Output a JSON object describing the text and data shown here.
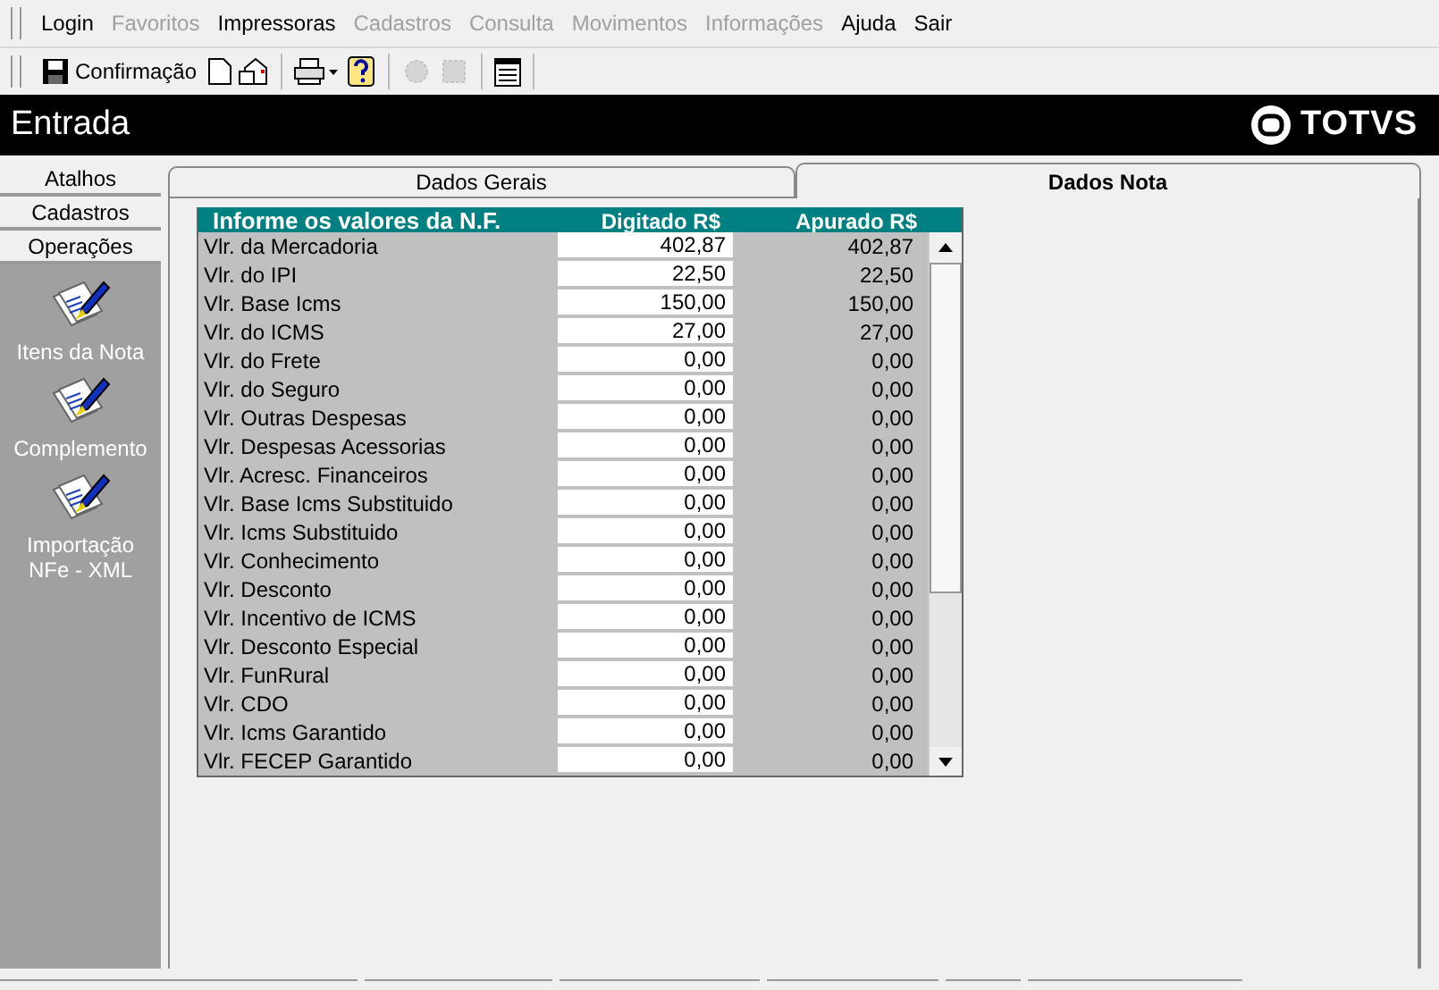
{
  "menu": [
    {
      "label": "Login",
      "disabled": false
    },
    {
      "label": "Favoritos",
      "disabled": true
    },
    {
      "label": "Impressoras",
      "disabled": false
    },
    {
      "label": "Cadastros",
      "disabled": true
    },
    {
      "label": "Consulta",
      "disabled": true
    },
    {
      "label": "Movimentos",
      "disabled": true
    },
    {
      "label": "Informações",
      "disabled": true
    },
    {
      "label": "Ajuda",
      "disabled": false
    },
    {
      "label": "Sair",
      "disabled": false
    }
  ],
  "toolbar": {
    "confirm_label": "Confirmação",
    "tools": [
      {
        "kind": "new",
        "disabled": false
      },
      {
        "kind": "open",
        "disabled": false
      },
      {
        "kind": "print",
        "disabled": false
      },
      {
        "kind": "help",
        "disabled": false
      },
      {
        "kind": "gearA",
        "disabled": true
      },
      {
        "kind": "gearB",
        "disabled": true
      },
      {
        "kind": "calendar",
        "disabled": false
      }
    ]
  },
  "header": {
    "title": "Entrada",
    "logo": "TOTVS"
  },
  "sidebar": {
    "sections": [
      "Atalhos",
      "Cadastros",
      "Operações"
    ],
    "items": [
      "Itens da Nota",
      "Complemento",
      "Importação NFe - XML"
    ]
  },
  "tabs": [
    {
      "label": "Dados Gerais",
      "selected": false
    },
    {
      "label": "Dados Nota",
      "selected": true
    }
  ],
  "table": {
    "columns": [
      "Informe os valores da N.F.",
      "Digitado  R$",
      "Apurado  R$"
    ],
    "rows": [
      [
        "Vlr. da Mercadoria",
        "402,87",
        "402,87"
      ],
      [
        "Vlr. do IPI",
        "22,50",
        "22,50"
      ],
      [
        "Vlr. Base Icms",
        "150,00",
        "150,00"
      ],
      [
        "Vlr. do ICMS",
        "27,00",
        "27,00"
      ],
      [
        "Vlr. do Frete",
        "0,00",
        "0,00"
      ],
      [
        "Vlr. do Seguro",
        "0,00",
        "0,00"
      ],
      [
        "Vlr. Outras Despesas",
        "0,00",
        "0,00"
      ],
      [
        "Vlr. Despesas Acessorias",
        "0,00",
        "0,00"
      ],
      [
        "Vlr. Acresc. Financeiros",
        "0,00",
        "0,00"
      ],
      [
        "Vlr. Base Icms Substituido",
        "0,00",
        "0,00"
      ],
      [
        "Vlr. Icms Substituido",
        "0,00",
        "0,00"
      ],
      [
        "Vlr. Conhecimento",
        "0,00",
        "0,00"
      ],
      [
        "Vlr. Desconto",
        "0,00",
        "0,00"
      ],
      [
        "Vlr. Incentivo de ICMS",
        "0,00",
        "0,00"
      ],
      [
        "Vlr. Desconto Especial",
        "0,00",
        "0,00"
      ],
      [
        "Vlr. FunRural",
        "0,00",
        "0,00"
      ],
      [
        "Vlr. CDO",
        "0,00",
        "0,00"
      ],
      [
        "Vlr. Icms Garantido",
        "0,00",
        "0,00"
      ],
      [
        "Vlr. FECEP Garantido",
        "0,00",
        "0,00"
      ]
    ]
  }
}
